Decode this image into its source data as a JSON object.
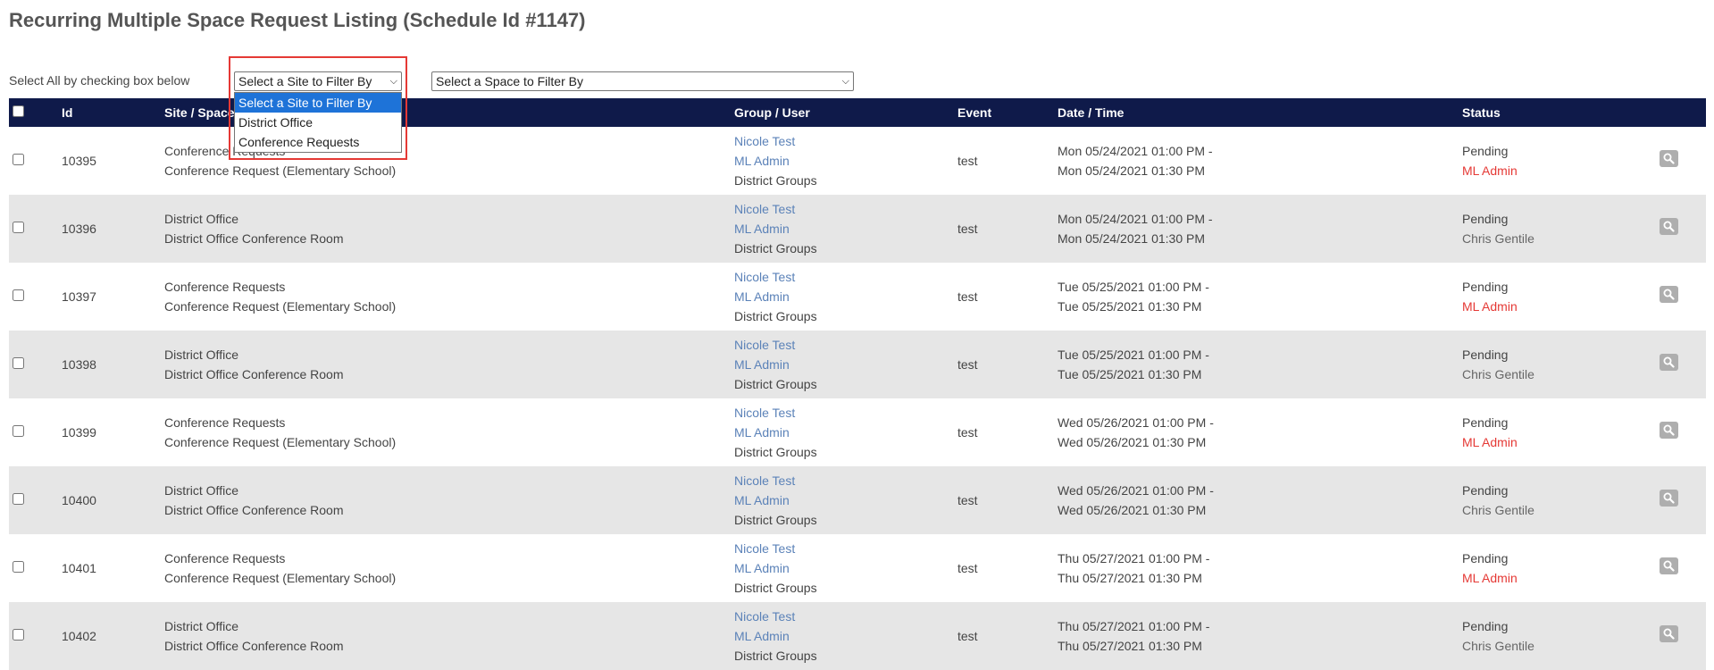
{
  "page": {
    "title": "Recurring Multiple Space Request Listing (Schedule Id #1147)"
  },
  "filters": {
    "hint": "Select All by checking box below",
    "site_select": {
      "value": "Select a Site to Filter By",
      "options": [
        "Select a Site to Filter By",
        "District Office",
        "Conference Requests"
      ]
    },
    "space_select": {
      "value": "Select a Space to Filter By"
    }
  },
  "table": {
    "headers": {
      "id": "Id",
      "site": "Site / Space",
      "group": "Group / User",
      "event": "Event",
      "date": "Date / Time",
      "status": "Status"
    },
    "rows": [
      {
        "id": "10395",
        "site": "Conference Requests",
        "space": "Conference Request (Elementary School)",
        "user": "Nicole Test",
        "admin": "ML Admin",
        "group": "District Groups",
        "event": "test",
        "start": "Mon 05/24/2021 01:00 PM -",
        "end": "Mon 05/24/2021 01:30 PM",
        "status": "Pending",
        "approver": "ML Admin",
        "approver_style": "red"
      },
      {
        "id": "10396",
        "site": "District Office",
        "space": "District Office Conference Room",
        "user": "Nicole Test",
        "admin": "ML Admin",
        "group": "District Groups",
        "event": "test",
        "start": "Mon 05/24/2021 01:00 PM -",
        "end": "Mon 05/24/2021 01:30 PM",
        "status": "Pending",
        "approver": "Chris Gentile",
        "approver_style": "grey"
      },
      {
        "id": "10397",
        "site": "Conference Requests",
        "space": "Conference Request (Elementary School)",
        "user": "Nicole Test",
        "admin": "ML Admin",
        "group": "District Groups",
        "event": "test",
        "start": "Tue 05/25/2021 01:00 PM -",
        "end": "Tue 05/25/2021 01:30 PM",
        "status": "Pending",
        "approver": "ML Admin",
        "approver_style": "red"
      },
      {
        "id": "10398",
        "site": "District Office",
        "space": "District Office Conference Room",
        "user": "Nicole Test",
        "admin": "ML Admin",
        "group": "District Groups",
        "event": "test",
        "start": "Tue 05/25/2021 01:00 PM -",
        "end": "Tue 05/25/2021 01:30 PM",
        "status": "Pending",
        "approver": "Chris Gentile",
        "approver_style": "grey"
      },
      {
        "id": "10399",
        "site": "Conference Requests",
        "space": "Conference Request (Elementary School)",
        "user": "Nicole Test",
        "admin": "ML Admin",
        "group": "District Groups",
        "event": "test",
        "start": "Wed 05/26/2021 01:00 PM -",
        "end": "Wed 05/26/2021 01:30 PM",
        "status": "Pending",
        "approver": "ML Admin",
        "approver_style": "red"
      },
      {
        "id": "10400",
        "site": "District Office",
        "space": "District Office Conference Room",
        "user": "Nicole Test",
        "admin": "ML Admin",
        "group": "District Groups",
        "event": "test",
        "start": "Wed 05/26/2021 01:00 PM -",
        "end": "Wed 05/26/2021 01:30 PM",
        "status": "Pending",
        "approver": "Chris Gentile",
        "approver_style": "grey"
      },
      {
        "id": "10401",
        "site": "Conference Requests",
        "space": "Conference Request (Elementary School)",
        "user": "Nicole Test",
        "admin": "ML Admin",
        "group": "District Groups",
        "event": "test",
        "start": "Thu 05/27/2021 01:00 PM -",
        "end": "Thu 05/27/2021 01:30 PM",
        "status": "Pending",
        "approver": "ML Admin",
        "approver_style": "red"
      },
      {
        "id": "10402",
        "site": "District Office",
        "space": "District Office Conference Room",
        "user": "Nicole Test",
        "admin": "ML Admin",
        "group": "District Groups",
        "event": "test",
        "start": "Thu 05/27/2021 01:00 PM -",
        "end": "Thu 05/27/2021 01:30 PM",
        "status": "Pending",
        "approver": "Chris Gentile",
        "approver_style": "grey"
      }
    ]
  },
  "icons": {
    "select_arrow": "chevron-down-icon",
    "view": "magnifier-icon"
  },
  "colors": {
    "header_bg": "#0f1a4a",
    "link": "#5b82b8",
    "alert_red": "#e53935",
    "highlight": "#e53935",
    "option_selected": "#1e73d8"
  }
}
